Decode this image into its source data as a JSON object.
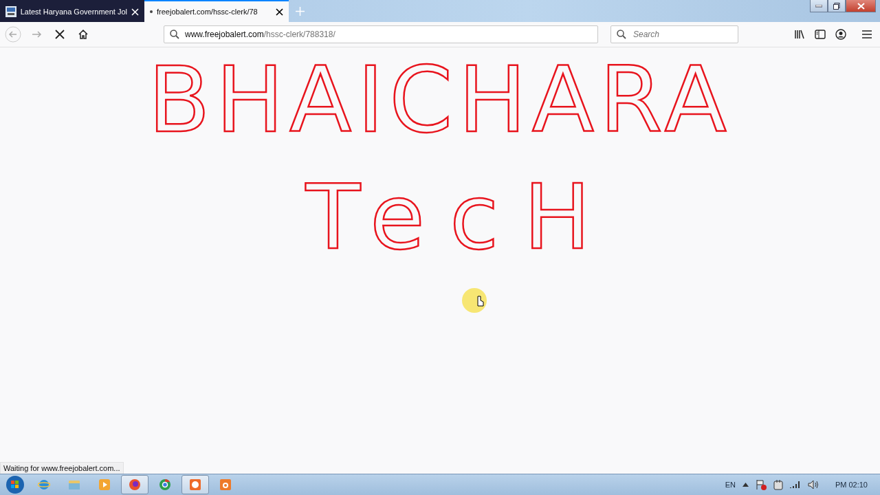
{
  "tabs": [
    {
      "title": "Latest Haryana Government Jol",
      "selected": false,
      "loading": false
    },
    {
      "title": "freejobalert.com/hssc-clerk/78",
      "selected": true,
      "loading": true
    }
  ],
  "address": {
    "domain": "www.freejobalert.com",
    "path": "/hssc-clerk/788318/"
  },
  "search": {
    "placeholder": "Search"
  },
  "drawing": {
    "lines": [
      "BHAICHARA",
      "TecH"
    ]
  },
  "status": "Waiting for www.freejobalert.com...",
  "taskbar": [
    {
      "kind": "ie",
      "selected": false
    },
    {
      "kind": "folder",
      "selected": false
    },
    {
      "kind": "media",
      "selected": false
    },
    {
      "kind": "firefox",
      "selected": true
    },
    {
      "kind": "chrome",
      "selected": false
    },
    {
      "kind": "recorder",
      "selected": true
    },
    {
      "kind": "camera",
      "selected": false
    }
  ],
  "tray": {
    "language": "EN",
    "clock": "PM 02:10"
  }
}
